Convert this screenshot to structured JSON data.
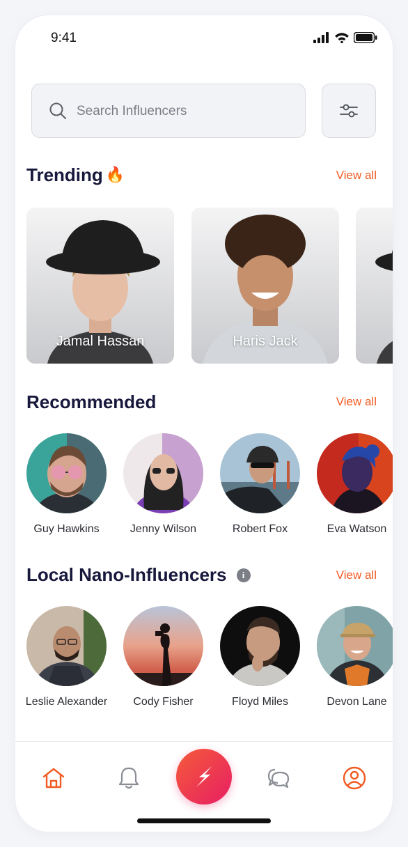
{
  "status_bar": {
    "time": "9:41"
  },
  "search": {
    "placeholder": "Search Influencers"
  },
  "trending": {
    "title": "Trending",
    "emoji": "🔥",
    "view_all": "View all",
    "cards": [
      {
        "name": "Jamal Hassan"
      },
      {
        "name": "Haris Jack"
      },
      {
        "name": ""
      }
    ]
  },
  "recommended": {
    "title": "Recommended",
    "view_all": "View all",
    "people": [
      {
        "name": "Guy Hawkins"
      },
      {
        "name": "Jenny Wilson"
      },
      {
        "name": "Robert Fox"
      },
      {
        "name": "Eva Watson"
      }
    ]
  },
  "local": {
    "title": "Local Nano-Influencers",
    "info_icon": "i",
    "view_all": "View all",
    "people": [
      {
        "name": "Leslie Alexander"
      },
      {
        "name": "Cody Fisher"
      },
      {
        "name": "Floyd Miles"
      },
      {
        "name": "Devon Lane"
      }
    ]
  },
  "colors": {
    "accent": "#f15a22",
    "fab_start": "#f45b3a",
    "fab_end": "#e81e63",
    "title": "#17183b"
  },
  "tabbar": {
    "icons": [
      "home-icon",
      "bell-icon",
      "lightning-icon",
      "chat-icon",
      "profile-icon"
    ]
  }
}
